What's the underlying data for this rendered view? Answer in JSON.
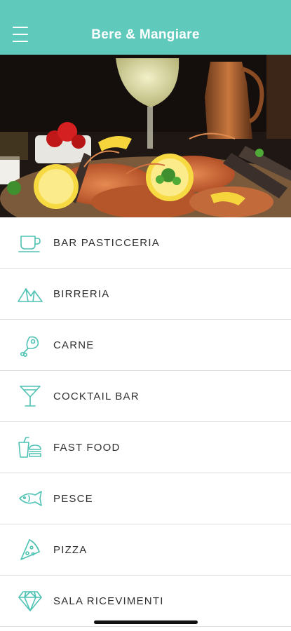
{
  "header": {
    "title": "Bere & Mangiare",
    "menu_icon": "hamburger-menu-icon",
    "background_color": "#5fc9bc"
  },
  "hero": {
    "image_subject": "seafood-platter-photo"
  },
  "accent_color": "#4fc2b4",
  "categories": [
    {
      "label": "BAR PASTICCERIA",
      "icon": "coffee-cup-icon"
    },
    {
      "label": "BIRRERIA",
      "icon": "mountains-icon"
    },
    {
      "label": "CARNE",
      "icon": "drumstick-icon"
    },
    {
      "label": "COCKTAIL BAR",
      "icon": "cocktail-glass-icon"
    },
    {
      "label": "FAST FOOD",
      "icon": "burger-drink-icon"
    },
    {
      "label": "PESCE",
      "icon": "fish-icon"
    },
    {
      "label": "PIZZA",
      "icon": "pizza-slice-icon"
    },
    {
      "label": "SALA RICEVIMENTI",
      "icon": "diamond-icon"
    }
  ]
}
